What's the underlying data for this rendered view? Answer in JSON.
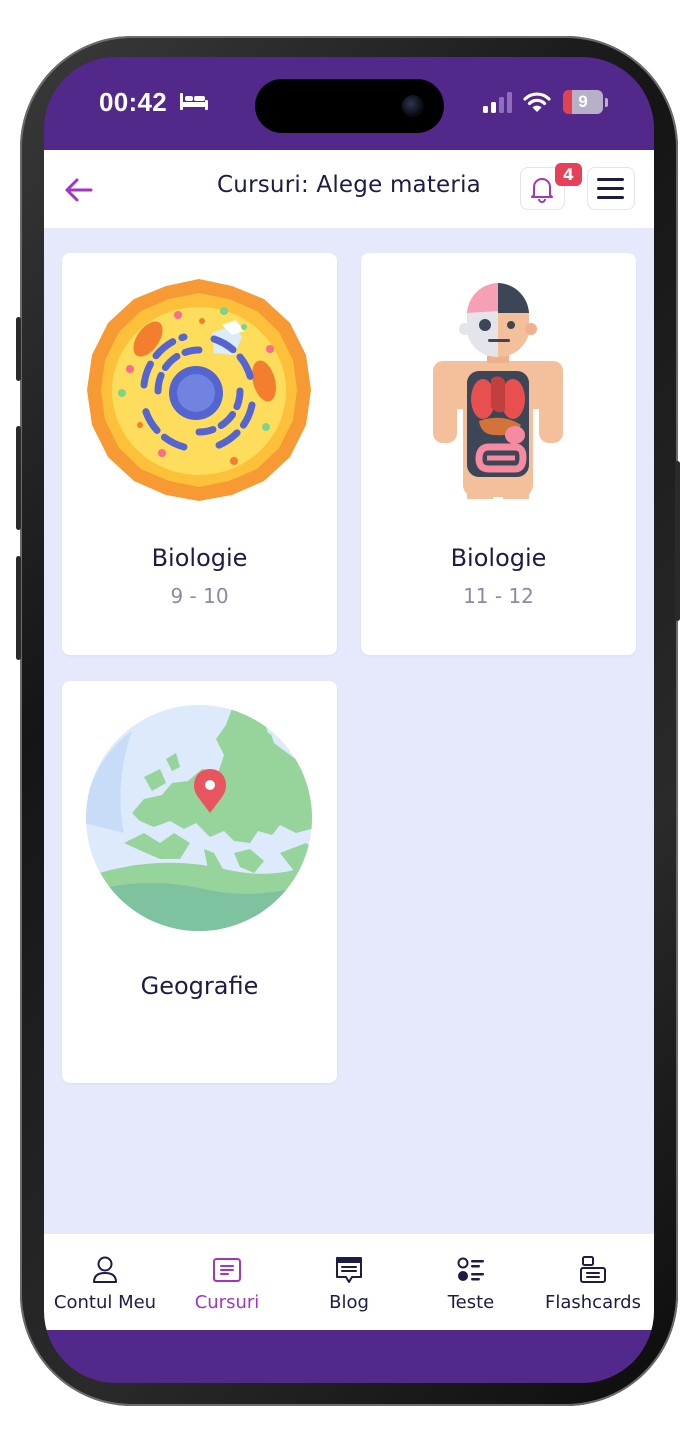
{
  "status_bar": {
    "time": "00:42",
    "battery_level": "9",
    "battery_color": "#e4404f"
  },
  "header": {
    "title": "Cursuri: Alege materia",
    "back_icon": "arrow-left-icon",
    "notification_count": "4",
    "notification_icon": "bell-icon",
    "menu_icon": "hamburger-menu-icon"
  },
  "courses": [
    {
      "title": "Biologie",
      "grades": "9 - 10",
      "icon": "cell-icon"
    },
    {
      "title": "Biologie",
      "grades": "11 - 12",
      "icon": "human-anatomy-icon"
    },
    {
      "title": "Geografie",
      "grades": "",
      "icon": "globe-europe-icon"
    }
  ],
  "bottom_nav": {
    "active": "Cursuri",
    "items": [
      {
        "label": "Contul Meu",
        "icon": "user-icon"
      },
      {
        "label": "Cursuri",
        "icon": "courses-icon"
      },
      {
        "label": "Blog",
        "icon": "blog-icon"
      },
      {
        "label": "Teste",
        "icon": "tests-icon"
      },
      {
        "label": "Flashcards",
        "icon": "flashcards-icon"
      }
    ]
  },
  "colors": {
    "brand_purple": "#52288a",
    "accent": "#a533c6",
    "text": "#1c1c45",
    "badge": "#e5425a",
    "content_bg": "#e5e9fb"
  }
}
